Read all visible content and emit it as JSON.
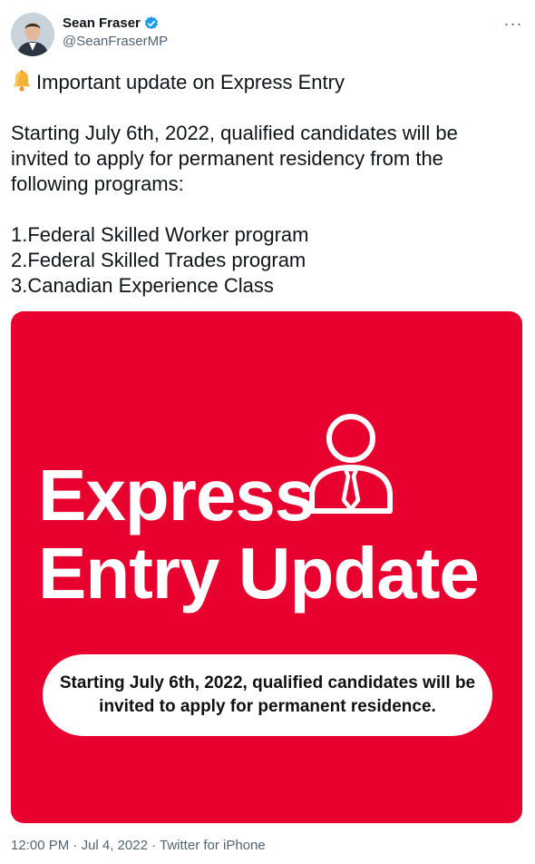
{
  "author": {
    "display_name": "Sean Fraser",
    "handle": "@SeanFraserMP",
    "verified_icon": "verified-badge-icon",
    "brand_color": "#1d9bf0"
  },
  "menu": {
    "more_label": "···"
  },
  "tweet": {
    "headline": "Important update on Express Entry",
    "headline_icon": "bell-icon",
    "body": "Starting July 6th, 2022, qualified candidates will be invited to apply for permanent residency from the following programs:",
    "programs": [
      "1.Federal Skilled Worker program",
      "2.Federal Skilled Trades program",
      "3.Canadian Experience Class"
    ]
  },
  "media": {
    "background_color": "#e8002f",
    "title_line1": "Express",
    "title_line2": "Entry Update",
    "pill_text": "Starting July 6th, 2022, qualified candidates will be invited to apply for permanent residence.",
    "illustration_icon": "person-with-tie-icon"
  },
  "meta": {
    "time": "12:00 PM",
    "separator": " · ",
    "date": "Jul 4, 2022",
    "source": "Twitter for iPhone"
  }
}
